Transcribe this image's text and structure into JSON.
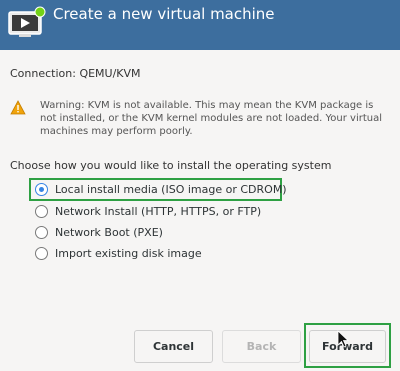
{
  "window": {
    "title": "Create a new virtual machine"
  },
  "connection": {
    "text": "Connection:  QEMU/KVM"
  },
  "warning": {
    "icon": "warning-triangle-icon",
    "text": "Warning: KVM is not available. This may mean the KVM package is not installed, or the KVM kernel modules are not loaded. Your virtual machines may perform poorly."
  },
  "install": {
    "prompt": "Choose how you would like to install the operating system",
    "options": [
      {
        "label": "Local install media (ISO image or CDROM)",
        "selected": true
      },
      {
        "label": "Network Install (HTTP, HTTPS, or FTP)",
        "selected": false
      },
      {
        "label": "Network Boot (PXE)",
        "selected": false
      },
      {
        "label": "Import existing disk image",
        "selected": false
      }
    ]
  },
  "buttons": {
    "cancel": "Cancel",
    "back": "Back",
    "forward": "Forward"
  },
  "colors": {
    "header": "#3d6e9e",
    "highlight": "#2ea043",
    "accent": "#3584e4"
  }
}
